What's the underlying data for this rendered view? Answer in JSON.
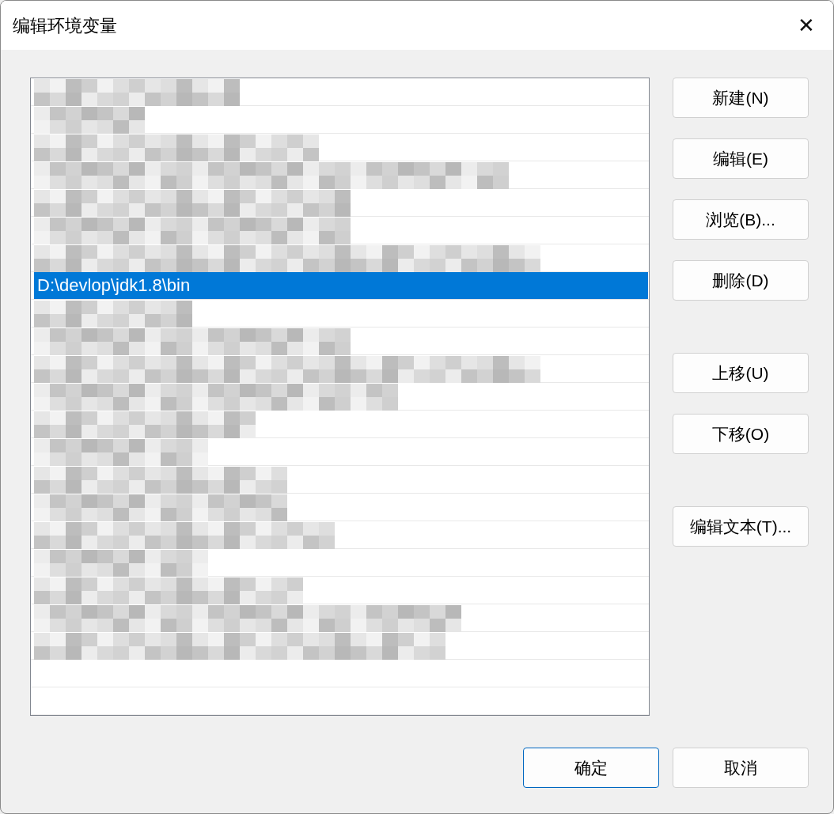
{
  "window": {
    "title": "编辑环境变量",
    "close": "✕"
  },
  "paths": [
    {
      "kind": "redacted",
      "selected": false
    },
    {
      "kind": "redacted",
      "selected": false
    },
    {
      "kind": "redacted",
      "selected": false
    },
    {
      "kind": "redacted",
      "selected": false
    },
    {
      "kind": "redacted",
      "selected": false
    },
    {
      "kind": "redacted",
      "selected": false
    },
    {
      "kind": "redacted",
      "selected": false
    },
    {
      "kind": "path",
      "text": "D:\\devlop\\jdk1.8\\bin",
      "selected": true
    },
    {
      "kind": "redacted",
      "selected": false
    },
    {
      "kind": "redacted",
      "selected": false
    },
    {
      "kind": "redacted",
      "selected": false
    },
    {
      "kind": "redacted",
      "selected": false
    },
    {
      "kind": "redacted",
      "selected": false
    },
    {
      "kind": "redacted",
      "selected": false
    },
    {
      "kind": "redacted",
      "selected": false
    },
    {
      "kind": "redacted",
      "selected": false
    },
    {
      "kind": "redacted",
      "selected": false
    },
    {
      "kind": "redacted",
      "selected": false
    },
    {
      "kind": "redacted",
      "selected": false
    },
    {
      "kind": "redacted",
      "selected": false
    },
    {
      "kind": "redacted",
      "selected": false
    }
  ],
  "side_button_groups": [
    [
      "新建(N)",
      "编辑(E)",
      "浏览(B)...",
      "删除(D)"
    ],
    [
      "上移(U)",
      "下移(O)"
    ],
    [
      "编辑文本(T)..."
    ]
  ],
  "footer_buttons": [
    {
      "label": "确定",
      "default": true
    },
    {
      "label": "取消",
      "default": false
    }
  ]
}
